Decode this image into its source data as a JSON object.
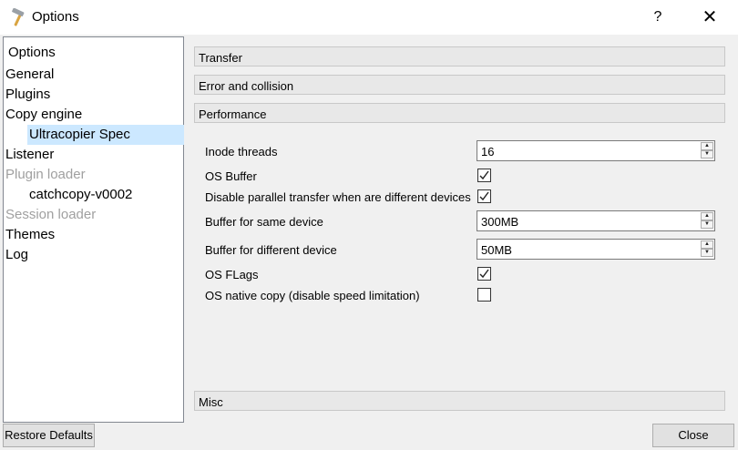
{
  "window": {
    "title": "Options",
    "help_glyph": "?",
    "close_glyph": "✕"
  },
  "tree": {
    "header": "Options",
    "items": [
      {
        "label": "General",
        "selected": false,
        "disabled": false
      },
      {
        "label": "Plugins",
        "selected": false,
        "disabled": false
      },
      {
        "label": "Copy engine",
        "selected": false,
        "disabled": false
      },
      {
        "label": "Ultracopier Spec",
        "selected": true,
        "disabled": false
      },
      {
        "label": "Listener",
        "selected": false,
        "disabled": false
      },
      {
        "label": "Plugin loader",
        "selected": false,
        "disabled": true
      },
      {
        "label": "catchcopy-v0002",
        "selected": false,
        "disabled": false
      },
      {
        "label": "Session loader",
        "selected": false,
        "disabled": true
      },
      {
        "label": "Themes",
        "selected": false,
        "disabled": false
      },
      {
        "label": "Log",
        "selected": false,
        "disabled": false
      }
    ]
  },
  "sections": {
    "transfer": "Transfer",
    "error": "Error and collision",
    "performance": "Performance",
    "misc": "Misc"
  },
  "performance": {
    "inode_threads_label": "Inode threads",
    "inode_threads_value": "16",
    "os_buffer_label": "OS Buffer",
    "os_buffer_checked": true,
    "parallel_label": "Disable parallel transfer when are different devices",
    "parallel_checked": true,
    "buffer_same_label": "Buffer for same device",
    "buffer_same_value": "300MB",
    "buffer_diff_label": "Buffer for different device",
    "buffer_diff_value": "50MB",
    "os_flags_label": "OS FLags",
    "os_flags_checked": true,
    "native_copy_label": "OS native copy (disable speed limitation)",
    "native_copy_checked": false
  },
  "buttons": {
    "restore": "Restore Defaults",
    "close": "Close"
  }
}
